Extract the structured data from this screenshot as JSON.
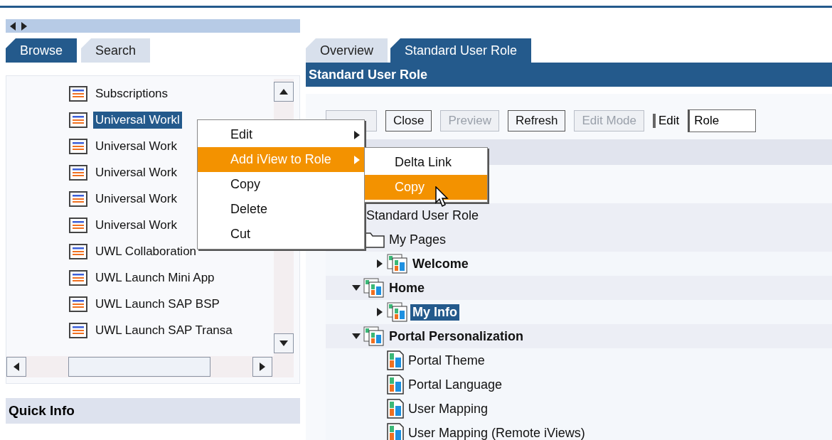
{
  "left_pane": {
    "tabs": [
      {
        "label": "Browse",
        "selected": true
      },
      {
        "label": "Search",
        "selected": false
      }
    ],
    "items": [
      {
        "label": "Subscriptions",
        "selected": false
      },
      {
        "label": "Universal Workl",
        "selected": true
      },
      {
        "label": "Universal Work",
        "selected": false
      },
      {
        "label": "Universal Work",
        "selected": false
      },
      {
        "label": "Universal Work",
        "selected": false
      },
      {
        "label": "Universal Work",
        "selected": false
      },
      {
        "label": "UWL Collaboration",
        "selected": false
      },
      {
        "label": "UWL Launch Mini App",
        "selected": false
      },
      {
        "label": "UWL Launch SAP BSP",
        "selected": false
      },
      {
        "label": "UWL Launch SAP Transa",
        "selected": false
      }
    ],
    "quick_info": "Quick Info"
  },
  "context_menu": {
    "items": [
      {
        "label": "Edit",
        "selected": false,
        "submenu": true
      },
      {
        "label": "Add iView to Role",
        "selected": true,
        "submenu": true
      },
      {
        "label": "Copy",
        "selected": false,
        "submenu": false
      },
      {
        "label": "Delete",
        "selected": false,
        "submenu": false
      },
      {
        "label": "Cut",
        "selected": false,
        "submenu": false
      }
    ],
    "submenu": [
      {
        "label": "Delta Link",
        "selected": false
      },
      {
        "label": "Copy",
        "selected": true
      }
    ]
  },
  "right_pane": {
    "tabs": [
      {
        "label": "Overview",
        "selected": false
      },
      {
        "label": "Standard User Role",
        "selected": true
      }
    ],
    "title": "Standard User Role",
    "toolbar": {
      "buttons": [
        {
          "label": "Close",
          "disabled": false
        },
        {
          "label": "Preview",
          "disabled": true
        },
        {
          "label": "Refresh",
          "disabled": false
        },
        {
          "label": "Edit Mode",
          "disabled": true
        }
      ],
      "edit_label": "Edit",
      "edit_value": "Role"
    },
    "tree": {
      "root": "Standard User Role",
      "children": [
        {
          "label": "My Pages",
          "kind": "folder",
          "bold": false,
          "selected": false,
          "children": [
            {
              "label": "Welcome",
              "kind": "page",
              "bold": true,
              "selected": false,
              "expanded": false
            }
          ]
        },
        {
          "label": "Home",
          "kind": "page",
          "bold": true,
          "selected": false,
          "expanded": true,
          "children": [
            {
              "label": "My Info",
              "kind": "page",
              "bold": true,
              "selected": true,
              "expanded": false
            }
          ]
        },
        {
          "label": "Portal Personalization",
          "kind": "page",
          "bold": true,
          "selected": false,
          "expanded": true,
          "children": [
            {
              "label": "Portal Theme",
              "kind": "iview",
              "bold": false,
              "selected": false
            },
            {
              "label": "Portal Language",
              "kind": "iview",
              "bold": false,
              "selected": false
            },
            {
              "label": "User Mapping",
              "kind": "iview",
              "bold": false,
              "selected": false
            },
            {
              "label": "User Mapping (Remote iViews)",
              "kind": "iview",
              "bold": false,
              "selected": false
            }
          ]
        }
      ]
    }
  }
}
